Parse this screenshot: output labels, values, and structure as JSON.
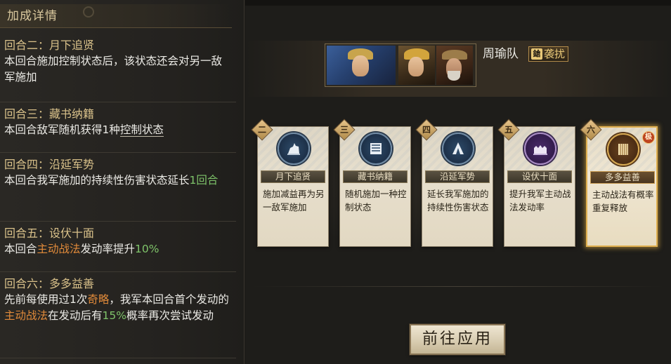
{
  "panel": {
    "title": "加成详情"
  },
  "bonuses": [
    {
      "head": "回合二：月下追贤",
      "desc_parts": [
        "本回合施加控制状态后，该状态还会对另一敌军施加"
      ]
    },
    {
      "head": "回合三：藏书纳籍",
      "desc_parts": [
        "本回合敌军随机获得1种",
        "控制状态"
      ]
    },
    {
      "head": "回合四：沿延军势",
      "desc_parts": [
        "本回合我军施加的持续性伤害状态延长",
        "1回合"
      ]
    },
    {
      "head": "回合五：设伏十面",
      "desc_parts": [
        "本回合",
        "主动战法",
        "发动率提升",
        "10%"
      ]
    },
    {
      "head": "回合六：多多益善",
      "desc_parts": [
        "先前每使用过1次",
        "奇略",
        "，我军本回合首个发动的",
        "主动战法",
        "在发动后有",
        "15%",
        "概率再次尝试发动"
      ]
    }
  ],
  "team": {
    "name": "周瑜队",
    "tag_icon": "鎗",
    "tag": "袭扰",
    "portraits": [
      "portrait-1",
      "portrait-2",
      "portrait-3"
    ]
  },
  "cards": [
    {
      "round": "二",
      "name": "月下追贤",
      "icon": "horse-rider-icon",
      "desc": "施加减益再为另一敌军施加"
    },
    {
      "round": "三",
      "name": "藏书纳籍",
      "icon": "scroll-icon",
      "desc": "随机施加一种控制状态"
    },
    {
      "round": "四",
      "name": "沿延军势",
      "icon": "tent-icon",
      "desc": "延长我军施加的持续性伤害状态"
    },
    {
      "round": "五",
      "name": "设伏十面",
      "icon": "fortress-icon",
      "desc": "提升我军主动战法发动率"
    },
    {
      "round": "六",
      "name": "多多益善",
      "icon": "bamboo-scroll-icon",
      "badge": "极",
      "desc": "主动战法有概率重复释放"
    }
  ],
  "apply_button": "前往应用",
  "colors": {
    "highlight_green": "#7fc46a",
    "highlight_orange": "#e08a3a",
    "gold_border": "#e0b050"
  }
}
